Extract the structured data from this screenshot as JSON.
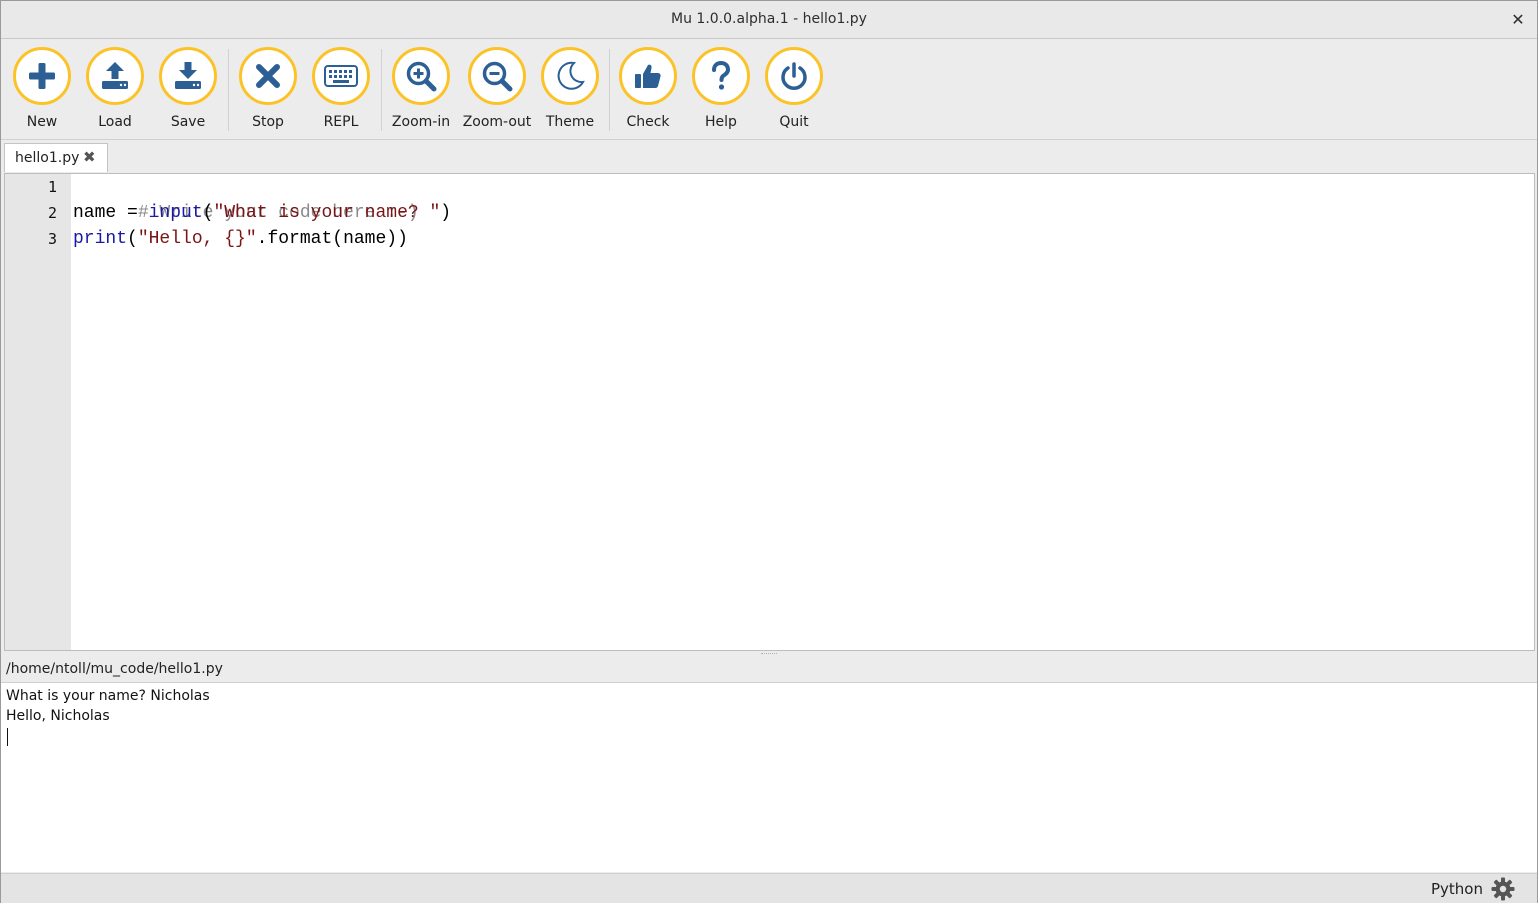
{
  "window": {
    "title": "Mu 1.0.0.alpha.1 - hello1.py",
    "close_glyph": "✕"
  },
  "toolbar": {
    "accent_color": "#fbc327",
    "icon_color": "#2c5f94",
    "buttons": [
      {
        "id": "new",
        "label": "New",
        "icon": "plus-icon"
      },
      {
        "id": "load",
        "label": "Load",
        "icon": "upload-icon"
      },
      {
        "id": "save",
        "label": "Save",
        "icon": "download-icon"
      },
      {
        "id": "stop",
        "label": "Stop",
        "icon": "x-icon"
      },
      {
        "id": "repl",
        "label": "REPL",
        "icon": "keyboard-icon"
      },
      {
        "id": "zoom-in",
        "label": "Zoom-in",
        "icon": "zoom-in-icon"
      },
      {
        "id": "zoom-out",
        "label": "Zoom-out",
        "icon": "zoom-out-icon"
      },
      {
        "id": "theme",
        "label": "Theme",
        "icon": "moon-icon"
      },
      {
        "id": "check",
        "label": "Check",
        "icon": "thumbs-up-icon"
      },
      {
        "id": "help",
        "label": "Help",
        "icon": "question-icon"
      },
      {
        "id": "quit",
        "label": "Quit",
        "icon": "power-icon"
      }
    ]
  },
  "tabs": [
    {
      "label": "hello1.py",
      "close_glyph": "✖",
      "active": true
    }
  ],
  "editor": {
    "line_numbers": [
      "1",
      "2",
      "3"
    ],
    "line1_comment": "# Write your code here :-)",
    "line2_a": "name = ",
    "line2_builtin": "input",
    "line2_b": "(",
    "line2_string": "\"What is your name? \"",
    "line2_c": ")",
    "line3_builtin": "print",
    "line3_b": "(",
    "line3_string": "\"Hello, {}\"",
    "line3_c": ".format(name))"
  },
  "runner": {
    "path": "/home/ntoll/mu_code/hello1.py",
    "output": [
      "What is your name? Nicholas",
      "Hello, Nicholas"
    ]
  },
  "statusbar": {
    "mode": "Python",
    "mode_icon": "gear-icon"
  }
}
